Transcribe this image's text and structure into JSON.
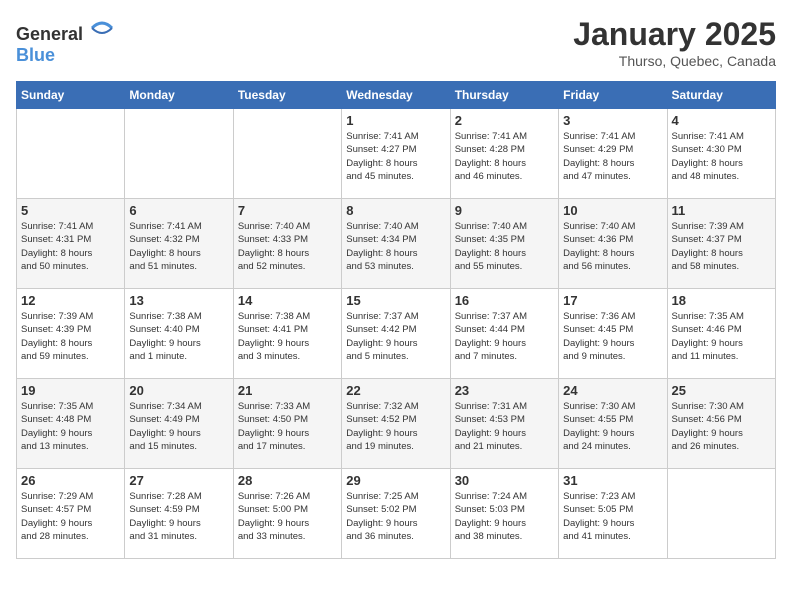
{
  "header": {
    "logo_general": "General",
    "logo_blue": "Blue",
    "title": "January 2025",
    "subtitle": "Thurso, Quebec, Canada"
  },
  "calendar": {
    "days_of_week": [
      "Sunday",
      "Monday",
      "Tuesday",
      "Wednesday",
      "Thursday",
      "Friday",
      "Saturday"
    ],
    "weeks": [
      [
        {
          "day": "",
          "info": ""
        },
        {
          "day": "",
          "info": ""
        },
        {
          "day": "",
          "info": ""
        },
        {
          "day": "1",
          "info": "Sunrise: 7:41 AM\nSunset: 4:27 PM\nDaylight: 8 hours\nand 45 minutes."
        },
        {
          "day": "2",
          "info": "Sunrise: 7:41 AM\nSunset: 4:28 PM\nDaylight: 8 hours\nand 46 minutes."
        },
        {
          "day": "3",
          "info": "Sunrise: 7:41 AM\nSunset: 4:29 PM\nDaylight: 8 hours\nand 47 minutes."
        },
        {
          "day": "4",
          "info": "Sunrise: 7:41 AM\nSunset: 4:30 PM\nDaylight: 8 hours\nand 48 minutes."
        }
      ],
      [
        {
          "day": "5",
          "info": "Sunrise: 7:41 AM\nSunset: 4:31 PM\nDaylight: 8 hours\nand 50 minutes."
        },
        {
          "day": "6",
          "info": "Sunrise: 7:41 AM\nSunset: 4:32 PM\nDaylight: 8 hours\nand 51 minutes."
        },
        {
          "day": "7",
          "info": "Sunrise: 7:40 AM\nSunset: 4:33 PM\nDaylight: 8 hours\nand 52 minutes."
        },
        {
          "day": "8",
          "info": "Sunrise: 7:40 AM\nSunset: 4:34 PM\nDaylight: 8 hours\nand 53 minutes."
        },
        {
          "day": "9",
          "info": "Sunrise: 7:40 AM\nSunset: 4:35 PM\nDaylight: 8 hours\nand 55 minutes."
        },
        {
          "day": "10",
          "info": "Sunrise: 7:40 AM\nSunset: 4:36 PM\nDaylight: 8 hours\nand 56 minutes."
        },
        {
          "day": "11",
          "info": "Sunrise: 7:39 AM\nSunset: 4:37 PM\nDaylight: 8 hours\nand 58 minutes."
        }
      ],
      [
        {
          "day": "12",
          "info": "Sunrise: 7:39 AM\nSunset: 4:39 PM\nDaylight: 8 hours\nand 59 minutes."
        },
        {
          "day": "13",
          "info": "Sunrise: 7:38 AM\nSunset: 4:40 PM\nDaylight: 9 hours\nand 1 minute."
        },
        {
          "day": "14",
          "info": "Sunrise: 7:38 AM\nSunset: 4:41 PM\nDaylight: 9 hours\nand 3 minutes."
        },
        {
          "day": "15",
          "info": "Sunrise: 7:37 AM\nSunset: 4:42 PM\nDaylight: 9 hours\nand 5 minutes."
        },
        {
          "day": "16",
          "info": "Sunrise: 7:37 AM\nSunset: 4:44 PM\nDaylight: 9 hours\nand 7 minutes."
        },
        {
          "day": "17",
          "info": "Sunrise: 7:36 AM\nSunset: 4:45 PM\nDaylight: 9 hours\nand 9 minutes."
        },
        {
          "day": "18",
          "info": "Sunrise: 7:35 AM\nSunset: 4:46 PM\nDaylight: 9 hours\nand 11 minutes."
        }
      ],
      [
        {
          "day": "19",
          "info": "Sunrise: 7:35 AM\nSunset: 4:48 PM\nDaylight: 9 hours\nand 13 minutes."
        },
        {
          "day": "20",
          "info": "Sunrise: 7:34 AM\nSunset: 4:49 PM\nDaylight: 9 hours\nand 15 minutes."
        },
        {
          "day": "21",
          "info": "Sunrise: 7:33 AM\nSunset: 4:50 PM\nDaylight: 9 hours\nand 17 minutes."
        },
        {
          "day": "22",
          "info": "Sunrise: 7:32 AM\nSunset: 4:52 PM\nDaylight: 9 hours\nand 19 minutes."
        },
        {
          "day": "23",
          "info": "Sunrise: 7:31 AM\nSunset: 4:53 PM\nDaylight: 9 hours\nand 21 minutes."
        },
        {
          "day": "24",
          "info": "Sunrise: 7:30 AM\nSunset: 4:55 PM\nDaylight: 9 hours\nand 24 minutes."
        },
        {
          "day": "25",
          "info": "Sunrise: 7:30 AM\nSunset: 4:56 PM\nDaylight: 9 hours\nand 26 minutes."
        }
      ],
      [
        {
          "day": "26",
          "info": "Sunrise: 7:29 AM\nSunset: 4:57 PM\nDaylight: 9 hours\nand 28 minutes."
        },
        {
          "day": "27",
          "info": "Sunrise: 7:28 AM\nSunset: 4:59 PM\nDaylight: 9 hours\nand 31 minutes."
        },
        {
          "day": "28",
          "info": "Sunrise: 7:26 AM\nSunset: 5:00 PM\nDaylight: 9 hours\nand 33 minutes."
        },
        {
          "day": "29",
          "info": "Sunrise: 7:25 AM\nSunset: 5:02 PM\nDaylight: 9 hours\nand 36 minutes."
        },
        {
          "day": "30",
          "info": "Sunrise: 7:24 AM\nSunset: 5:03 PM\nDaylight: 9 hours\nand 38 minutes."
        },
        {
          "day": "31",
          "info": "Sunrise: 7:23 AM\nSunset: 5:05 PM\nDaylight: 9 hours\nand 41 minutes."
        },
        {
          "day": "",
          "info": ""
        }
      ]
    ]
  }
}
